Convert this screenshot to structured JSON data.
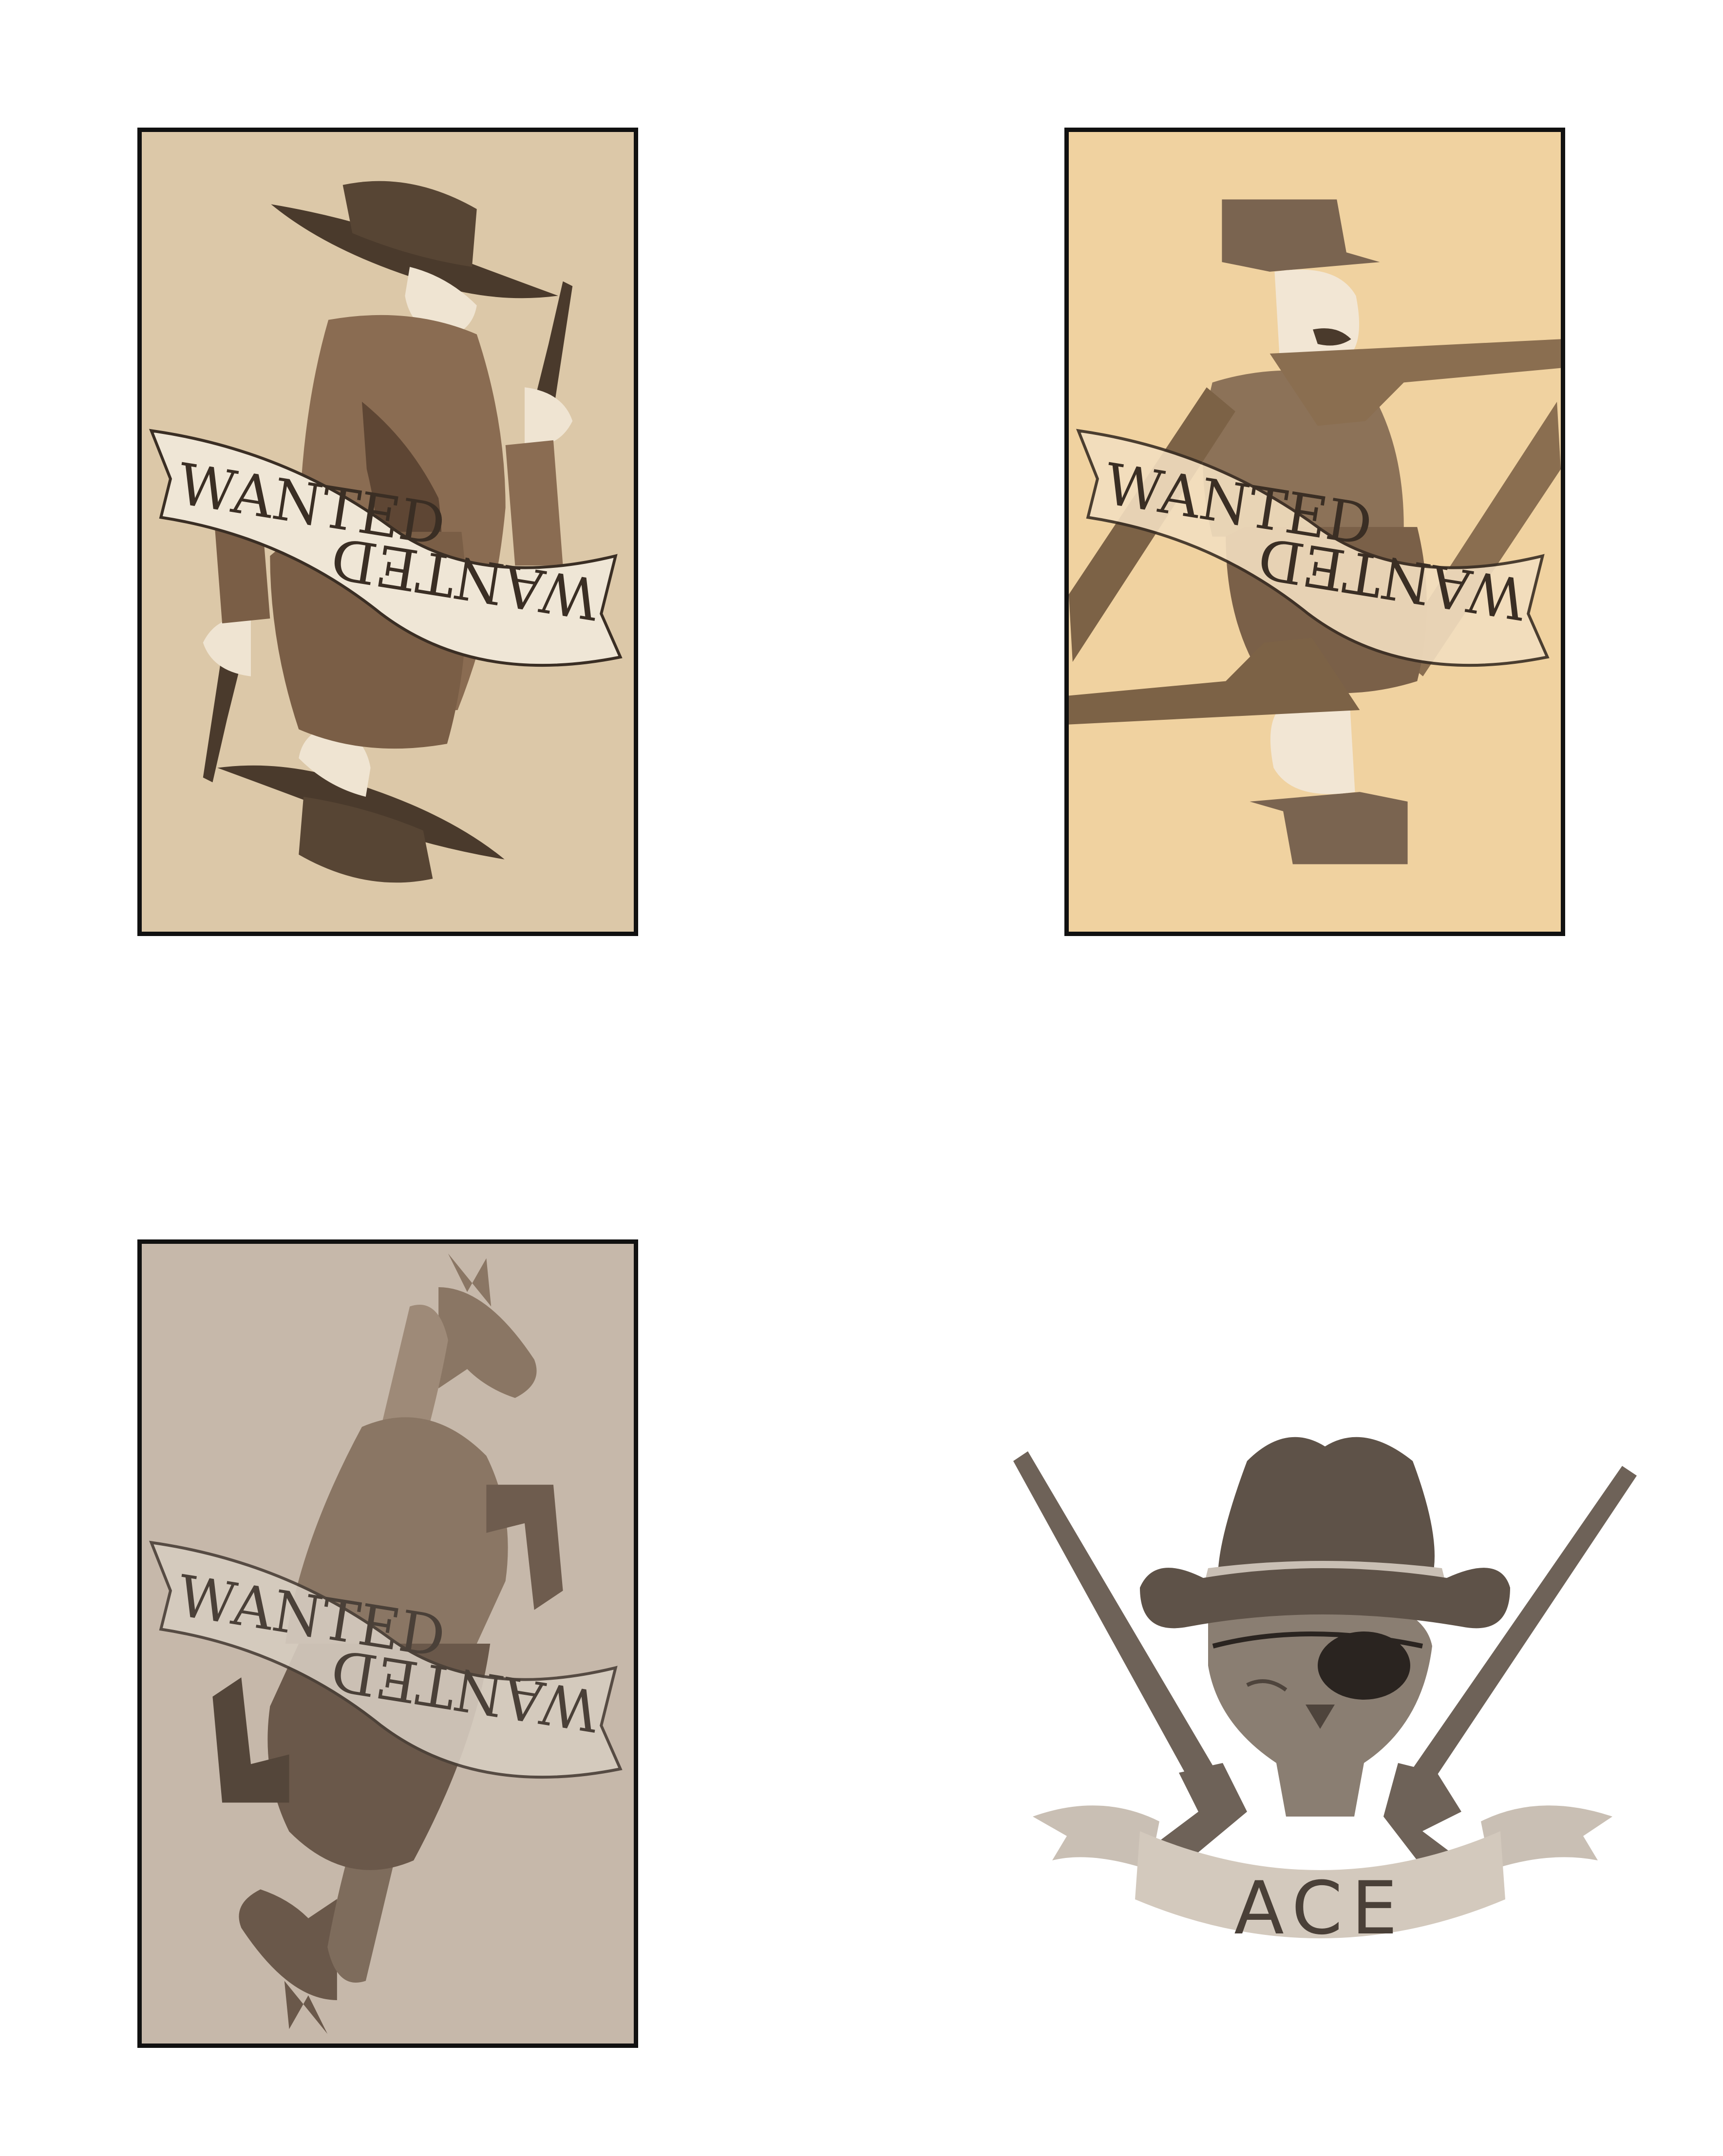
{
  "colors": {
    "page_bg": "#ffffff",
    "card_border": "#111111",
    "card1_bg": "#dcc8a8",
    "card2_bg": "#f0d2a0",
    "card3_bg": "#c6b8aa",
    "ink_dark": "#4a3a2c",
    "ink_mid": "#7a6450",
    "ace_brown": "#5e5248",
    "ribbon": "#c9bfb4"
  },
  "cards": [
    {
      "figure": "gunslinger-in-wide-brim-hat",
      "banner_top": "WANTED",
      "banner_bottom": "WANTED"
    },
    {
      "figure": "rifleman-with-cap",
      "banner_top": "WANTED",
      "banner_bottom": "WANTED"
    },
    {
      "figure": "rearing-horse",
      "banner_top": "WANTED",
      "banner_bottom": "WANTED"
    }
  ],
  "ace": {
    "emblem": "skull-in-cowboy-hat-with-crossed-rifles",
    "label": "ACE"
  }
}
